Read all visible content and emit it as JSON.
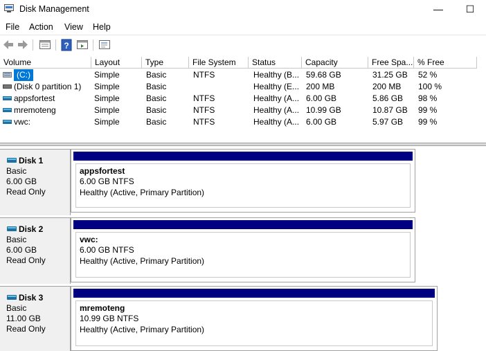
{
  "window": {
    "title": "Disk Management",
    "minimize_label": "—",
    "maximize_label": "☐"
  },
  "menu": [
    "File",
    "Action",
    "View",
    "Help"
  ],
  "toolbar": {
    "icons": [
      "back-arrow-icon",
      "forward-arrow-icon",
      "properties-panel-icon",
      "help-icon",
      "show-hide-console-tree-icon",
      "settings-list-icon"
    ]
  },
  "volume_table": {
    "columns": [
      "Volume",
      "Layout",
      "Type",
      "File System",
      "Status",
      "Capacity",
      "Free Spa...",
      "% Free"
    ],
    "rows": [
      {
        "volume": "(C:)",
        "layout": "Simple",
        "type": "Basic",
        "file_system": "NTFS",
        "status": "Healthy (B...",
        "capacity": "59.68 GB",
        "free_space": "31.25 GB",
        "percent_free": "52 %",
        "selected": true
      },
      {
        "volume": "(Disk 0 partition 1)",
        "layout": "Simple",
        "type": "Basic",
        "file_system": "",
        "status": "Healthy (E...",
        "capacity": "200 MB",
        "free_space": "200 MB",
        "percent_free": "100 %",
        "selected": false
      },
      {
        "volume": "appsfortest",
        "layout": "Simple",
        "type": "Basic",
        "file_system": "NTFS",
        "status": "Healthy (A...",
        "capacity": "6.00 GB",
        "free_space": "5.86 GB",
        "percent_free": "98 %",
        "selected": false
      },
      {
        "volume": "mremoteng",
        "layout": "Simple",
        "type": "Basic",
        "file_system": "NTFS",
        "status": "Healthy (A...",
        "capacity": "10.99 GB",
        "free_space": "10.87 GB",
        "percent_free": "99 %",
        "selected": false
      },
      {
        "volume": "vwc:",
        "layout": "Simple",
        "type": "Basic",
        "file_system": "NTFS",
        "status": "Healthy (A...",
        "capacity": "6.00 GB",
        "free_space": "5.97 GB",
        "percent_free": "99 %",
        "selected": false
      }
    ]
  },
  "disks": [
    {
      "name": "Disk 1",
      "type": "Basic",
      "size": "6.00 GB",
      "state": "Read Only",
      "partition": {
        "name": "appsfortest",
        "size_fs": "6.00 GB NTFS",
        "status": "Healthy (Active, Primary Partition)"
      }
    },
    {
      "name": "Disk 2",
      "type": "Basic",
      "size": "6.00 GB",
      "state": "Read Only",
      "partition": {
        "name": "vwc:",
        "size_fs": "6.00 GB NTFS",
        "status": "Healthy (Active, Primary Partition)"
      }
    },
    {
      "name": "Disk 3",
      "type": "Basic",
      "size": "11.00 GB",
      "state": "Read Only",
      "partition": {
        "name": "mremoteng",
        "size_fs": "10.99 GB NTFS",
        "status": "Healthy (Active, Primary Partition)"
      }
    }
  ],
  "colors": {
    "partition_bar": "#000080",
    "selection": "#0078d7"
  }
}
